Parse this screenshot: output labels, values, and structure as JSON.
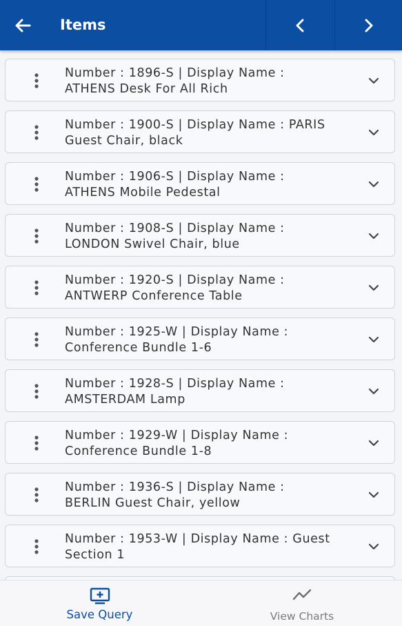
{
  "header": {
    "title": "Items",
    "back_icon": "arrow-left-icon",
    "prev_icon": "chevron-left-icon",
    "next_icon": "chevron-right-icon",
    "bg_color": "#0b4ea2"
  },
  "items": [
    {
      "line1": "Number  : 1896-S | Display Name  :",
      "line2": "ATHENS Desk For All Rich"
    },
    {
      "line1": "Number  : 1900-S | Display Name  : PARIS",
      "line2": "Guest Chair, black"
    },
    {
      "line1": "Number  : 1906-S | Display Name  :",
      "line2": "ATHENS Mobile Pedestal"
    },
    {
      "line1": "Number  : 1908-S | Display Name  :",
      "line2": "LONDON Swivel Chair, blue"
    },
    {
      "line1": "Number  : 1920-S | Display Name  :",
      "line2": "ANTWERP Conference Table"
    },
    {
      "line1": "Number  : 1925-W | Display Name  :",
      "line2": "Conference Bundle 1-6"
    },
    {
      "line1": "Number  : 1928-S | Display Name  :",
      "line2": "AMSTERDAM Lamp"
    },
    {
      "line1": "Number  : 1929-W | Display Name  :",
      "line2": "Conference Bundle 1-8"
    },
    {
      "line1": "Number  : 1936-S | Display Name  :",
      "line2": "BERLIN Guest Chair, yellow"
    },
    {
      "line1": "Number  : 1953-W | Display Name  : Guest",
      "line2": "Section 1"
    }
  ],
  "bottom_nav": {
    "save_query": "Save Query",
    "view_charts": "View Charts",
    "active_color": "#0b4ea2"
  }
}
